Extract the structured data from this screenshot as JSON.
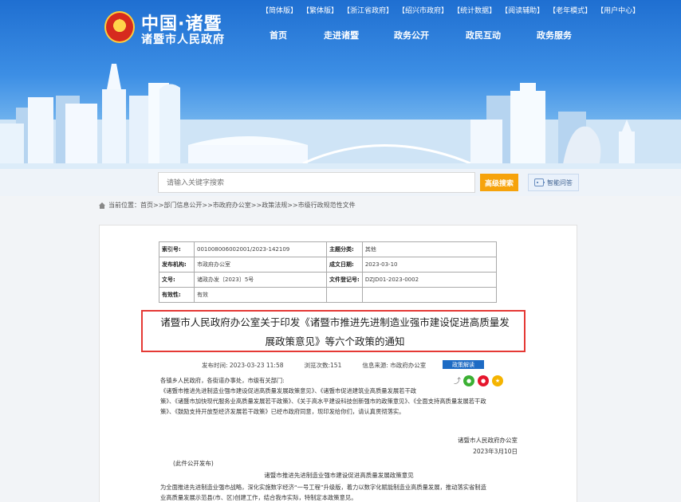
{
  "header": {
    "logo_title": "中国·诸暨",
    "logo_subtitle": "诸暨市人民政府",
    "top_links": [
      "【简体版】",
      "【繁体版】",
      "【浙江省政府】",
      "【绍兴市政府】",
      "【统计数据】",
      "【阅读辅助】",
      "【老年模式】",
      "【用户中心】"
    ],
    "nav": [
      "首页",
      "走进诸暨",
      "政务公开",
      "政民互动",
      "政务服务"
    ]
  },
  "search": {
    "placeholder": "请输入关键字搜索",
    "advanced_label": "高级搜索",
    "ai_label": "智能问答"
  },
  "breadcrumb": "当前位置：首页>>部门信息公开>>市政府办公室>>政策法规>>市级行政规范性文件",
  "meta": {
    "rows": [
      {
        "k1": "索引号:",
        "v1": "001008006002001/2023-142109",
        "k2": "主题分类:",
        "v2": "其他"
      },
      {
        "k1": "发布机构:",
        "v1": "市政府办公室",
        "k2": "成文日期:",
        "v2": "2023-03-10"
      },
      {
        "k1": "文号:",
        "v1": "诸政办发〔2023〕5号",
        "k2": "文件登记号:",
        "v2": "DZJD01-2023-0002"
      },
      {
        "k1": "有效性:",
        "v1": "有效",
        "k2": "",
        "v2": ""
      }
    ]
  },
  "article": {
    "title_line1": "诸暨市人民政府办公室关于印发《诸暨市推进先进制造业强市建设促进高质量发",
    "title_line2": "展政策意见》等六个政策的通知",
    "publish_time": "发布时间:  2023-03-23 11:58",
    "views": "浏览次数:151",
    "source": "信息来源:  市政府办公室",
    "interpretation_label": "政策解读",
    "body_lines": [
      "各镇乡人民政府，各街道办事处，市级有关部门:",
      "        《诸暨市推进先进制造业强市建设促进高质量发展政策意见》、《诸暨市促进建筑业高质量发展若干政",
      "策》、《诸暨市加快现代服务业高质量发展若干政策》、《关于高水平建设科技创新强市的政策意见》、《全面支持高质量发展若干政",
      "策》、《鼓励支持开放型经济发展若干政策》已经市政府同意，现印发给你们，请认真贯彻落实。"
    ],
    "sign_org": "诸暨市人民政府办公室",
    "sign_date": "2023年3月10日",
    "open_note": "(此件公开发布)",
    "sub_title": "诸暨市推进先进制造业强市建设促进高质量发展政策意见",
    "para2_lines": [
      "        为全面推进先进制造业强市战略，深化实施数字经济“一号工程”升级版，着力以数字化赋能制造业高质量发展，推动落实省制造",
      "业高质量发展示范县(市、区)创建工作，结合我市实际，特制定本政策意见。"
    ]
  },
  "colors": {
    "banner_top": "#1f6fd1",
    "accent_orange": "#f6a30c",
    "title_highlight": "#e53935",
    "interp_blue": "#1d6bc4"
  },
  "icons": [
    "home-icon",
    "robot-icon",
    "share-icon",
    "wechat-icon",
    "weibo-icon",
    "qzone-icon"
  ]
}
